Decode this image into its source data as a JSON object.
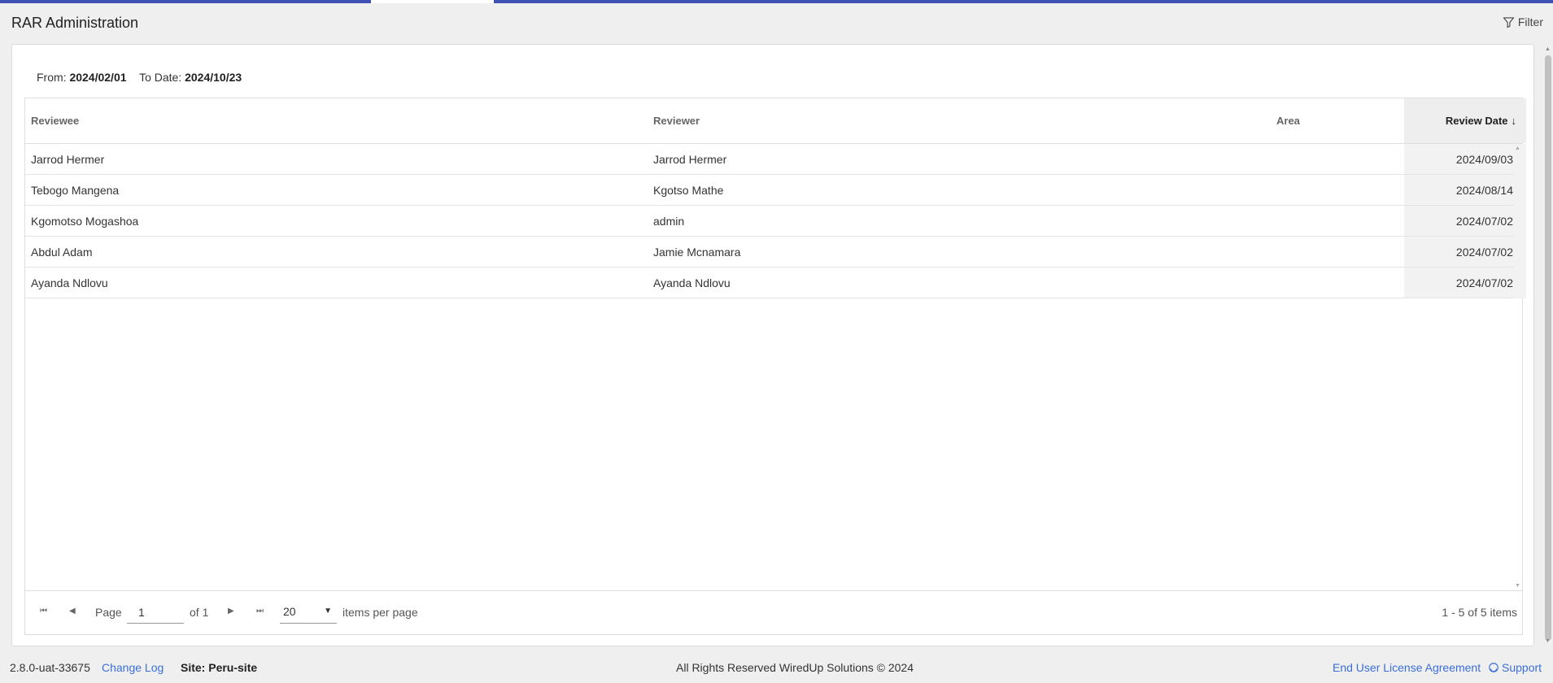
{
  "header": {
    "title": "RAR Administration",
    "filter_label": "Filter"
  },
  "date_range": {
    "from_label": "From:",
    "from_value": "2024/02/01",
    "to_label": "To Date:",
    "to_value": "2024/10/23"
  },
  "table": {
    "columns": {
      "reviewee": "Reviewee",
      "reviewer": "Reviewer",
      "area": "Area",
      "review_date": "Review Date"
    },
    "sort_indicator": "↓",
    "rows": [
      {
        "reviewee": "Jarrod Hermer",
        "reviewer": "Jarrod Hermer",
        "area": "",
        "review_date": "2024/09/03"
      },
      {
        "reviewee": "Tebogo Mangena",
        "reviewer": "Kgotso Mathe",
        "area": "",
        "review_date": "2024/08/14"
      },
      {
        "reviewee": "Kgomotso Mogashoa",
        "reviewer": "admin",
        "area": "",
        "review_date": "2024/07/02"
      },
      {
        "reviewee": "Abdul Adam",
        "reviewer": "Jamie Mcnamara",
        "area": "",
        "review_date": "2024/07/02"
      },
      {
        "reviewee": "Ayanda Ndlovu",
        "reviewer": "Ayanda Ndlovu",
        "area": "",
        "review_date": "2024/07/02"
      }
    ]
  },
  "pager": {
    "page_label": "Page",
    "page_value": "1",
    "of_label": "of 1",
    "page_size": "20",
    "items_per_page_label": "items per page",
    "summary": "1 - 5 of 5 items"
  },
  "footer": {
    "version": "2.8.0-uat-33675",
    "change_log": "Change Log",
    "site": "Site: Peru-site",
    "copyright": "All Rights Reserved WiredUp Solutions © 2024",
    "eula": "End User License Agreement",
    "support": "Support"
  },
  "icons": {
    "filter": "filter-icon",
    "support": "support-icon",
    "first_page": "first-page-icon",
    "prev_page": "prev-page-icon",
    "next_page": "next-page-icon",
    "last_page": "last-page-icon"
  },
  "colors": {
    "accent_bar": "#3f51b5",
    "link": "#3a6fd8",
    "sorted_column_bg": "#eeeeee"
  }
}
